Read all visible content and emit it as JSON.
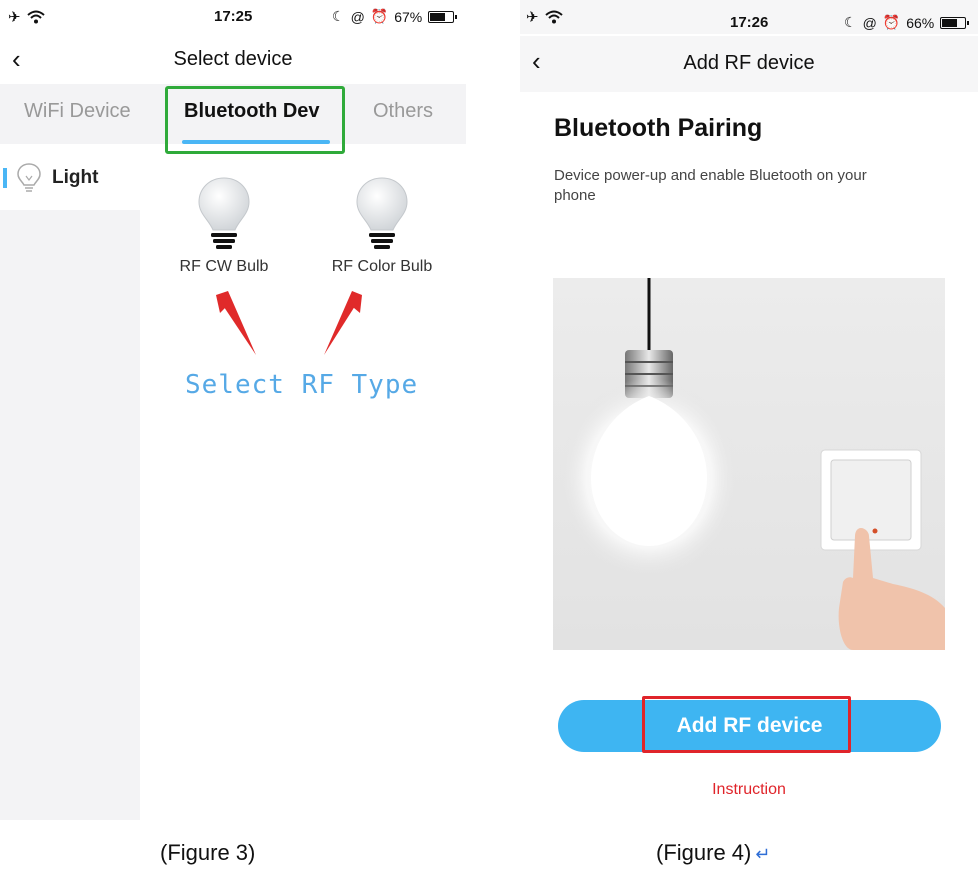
{
  "left_screen": {
    "status": {
      "time": "17:25",
      "battery": "67%",
      "battery_fill": 0.67
    },
    "nav": {
      "back_icon": "chevron-left-icon",
      "title": "Select device"
    },
    "tabs": [
      {
        "label": "WiFi Device",
        "active": false
      },
      {
        "label": "Bluetooth Dev",
        "active": true
      },
      {
        "label": "Others",
        "active": false
      }
    ],
    "sidebar": {
      "items": [
        {
          "label": "Light",
          "icon": "bulb-outline-icon",
          "selected": true
        }
      ]
    },
    "devices": [
      {
        "label": "RF CW Bulb",
        "icon": "bulb-icon"
      },
      {
        "label": "RF Color Bulb",
        "icon": "bulb-icon"
      }
    ],
    "annotation": "Select RF Type",
    "colors": {
      "accent": "#4ab6f5",
      "highlight": "#2faa3a",
      "arrow": "#e02a2a",
      "annotation": "#56a9e6"
    }
  },
  "right_screen": {
    "status": {
      "time": "17:26",
      "battery": "66%",
      "battery_fill": 0.66
    },
    "nav": {
      "back_icon": "chevron-left-icon",
      "title": "Add RF device"
    },
    "heading": "Bluetooth Pairing",
    "description": "Device power-up and enable Bluetooth on your phone",
    "primary_button": "Add RF device",
    "link": "Instruction",
    "colors": {
      "button": "#3eb5f2",
      "highlight": "#e0242a",
      "link": "#e0242a"
    }
  },
  "captions": {
    "left": "(Figure 3)",
    "right": "(Figure 4)"
  }
}
